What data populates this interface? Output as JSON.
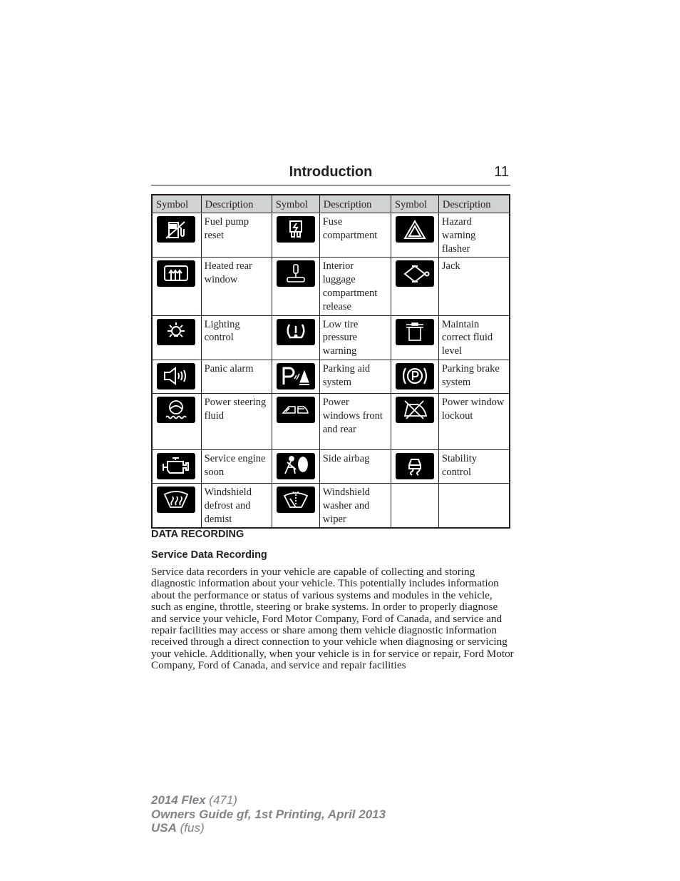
{
  "header": {
    "title": "Introduction",
    "page_number": "11"
  },
  "symbol_table": {
    "columns": [
      "Symbol",
      "Description",
      "Symbol",
      "Description",
      "Symbol",
      "Description"
    ],
    "rows": [
      [
        {
          "icon": "fuel-pump-reset-icon",
          "description": "Fuel pump reset"
        },
        {
          "icon": "fuse-compartment-icon",
          "description": "Fuse compartment"
        },
        {
          "icon": "hazard-warning-icon",
          "description": "Hazard warning flasher"
        }
      ],
      [
        {
          "icon": "heated-rear-window-icon",
          "description": "Heated rear window"
        },
        {
          "icon": "interior-luggage-release-icon",
          "description": "Interior luggage compartment release"
        },
        {
          "icon": "jack-icon",
          "description": "Jack"
        }
      ],
      [
        {
          "icon": "lighting-control-icon",
          "description": "Lighting control"
        },
        {
          "icon": "low-tire-pressure-icon",
          "description": "Low tire pressure warning"
        },
        {
          "icon": "fluid-level-icon",
          "description": "Maintain correct fluid level"
        }
      ],
      [
        {
          "icon": "panic-alarm-icon",
          "description": "Panic alarm"
        },
        {
          "icon": "parking-aid-icon",
          "description": "Parking aid system"
        },
        {
          "icon": "parking-brake-icon",
          "description": "Parking brake system"
        }
      ],
      [
        {
          "icon": "power-steering-fluid-icon",
          "description": "Power steering fluid"
        },
        {
          "icon": "power-windows-icon",
          "description": "Power windows front and rear"
        },
        {
          "icon": "power-window-lockout-icon",
          "description": "Power window lockout"
        }
      ],
      [
        {
          "icon": "service-engine-icon",
          "description": "Service engine soon"
        },
        {
          "icon": "side-airbag-icon",
          "description": "Side airbag"
        },
        {
          "icon": "stability-control-icon",
          "description": "Stability control"
        }
      ],
      [
        {
          "icon": "windshield-defrost-icon",
          "description": "Windshield defrost and demist"
        },
        {
          "icon": "windshield-washer-icon",
          "description": "Windshield washer and wiper"
        },
        {
          "icon": "",
          "description": ""
        }
      ]
    ]
  },
  "section": {
    "heading": "DATA RECORDING",
    "subheading": "Service Data Recording",
    "paragraph": "Service data recorders in your vehicle are capable of collecting and storing diagnostic information about your vehicle. This potentially includes information about the performance or status of various systems and modules in the vehicle, such as engine, throttle, steering or brake systems. In order to properly diagnose and service your vehicle, Ford Motor Company, Ford of Canada, and service and repair facilities may access or share among them vehicle diagnostic information received through a direct connection to your vehicle when diagnosing or servicing your vehicle. Additionally, when your vehicle is in for service or repair, Ford Motor Company, Ford of Canada, and service and repair facilities"
  },
  "footer": {
    "line1_bold": "2014 Flex",
    "line1_rest": " (471)",
    "line2_bold": "Owners Guide gf, 1st Printing, April 2013",
    "line3_bold": "USA",
    "line3_rest": " (fus)"
  },
  "colors": {
    "text": "#231f20",
    "table_header_bg": "#d1d2d4",
    "footer_text": "#808285",
    "icon_bg": "#000000"
  }
}
